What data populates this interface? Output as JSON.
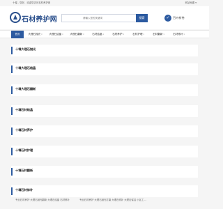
{
  "topbar": {
    "welcome": "十堰 - 您好，欢迎您访问石材养护网",
    "right_link": "网站地图 ▾ "
  },
  "header": {
    "logo_text": "石材养护网",
    "search_placeholder": "请输入您的关键词",
    "search_button": "搜索",
    "fav_label": "百叶新卷",
    "brand_color": "#2c5aa0"
  },
  "nav": {
    "items": [
      {
        "label": "首页",
        "active": true
      },
      {
        "label": "大理石抛光",
        "caret": true
      },
      {
        "label": "大理石结晶",
        "caret": true
      },
      {
        "label": "大理石翻新",
        "caret": true
      },
      {
        "label": "石材结晶",
        "caret": true
      },
      {
        "label": "石材养护",
        "caret": true
      },
      {
        "label": "石材护理",
        "caret": true
      },
      {
        "label": "石材翻新",
        "caret": true
      },
      {
        "label": "石材修补",
        "caret": true
      }
    ]
  },
  "sections": [
    {
      "title": "十堰大理石抛光"
    },
    {
      "title": "十堰大理石结晶"
    },
    {
      "title": "十堰大理石翻新"
    },
    {
      "title": "十堰石材结晶"
    },
    {
      "title": "十堰石材养护"
    },
    {
      "title": "十堰石材护理"
    },
    {
      "title": "十堰石材翻新"
    },
    {
      "title": "十堰石材修补"
    }
  ],
  "footer_links": [
    "专业石材养护 大理石抛光翻新 大理石结晶 石材修补",
    "专业石材养护 大理石抛光打磨 大理石修补 大理石保洁 小区工..."
  ]
}
